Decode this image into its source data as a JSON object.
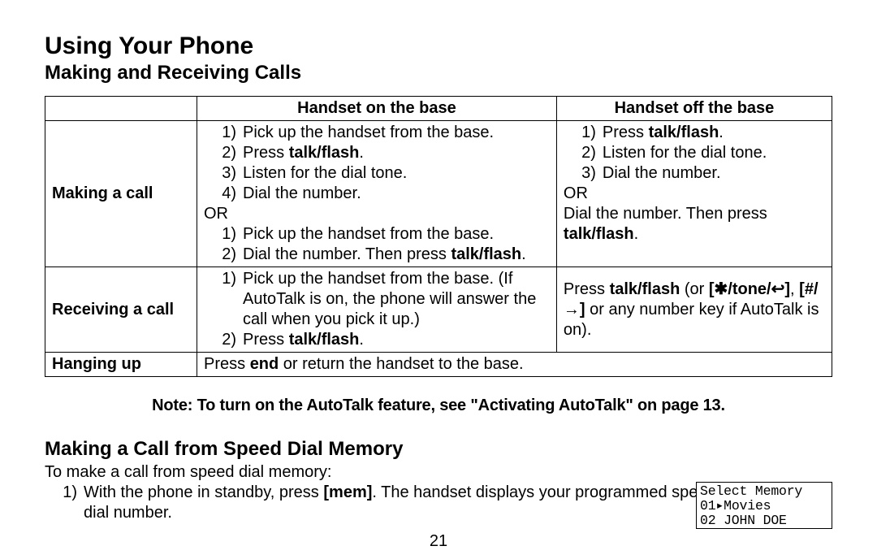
{
  "title": "Using Your Phone",
  "subtitle": "Making and Receiving Calls",
  "table": {
    "head_on": "Handset on the base",
    "head_off": "Handset off the base",
    "row1": {
      "label": "Making a call",
      "on": {
        "a1": "Pick up the handset from the base.",
        "a2_pre": "Press ",
        "a2_b": "talk/flash",
        "a2_post": ".",
        "a3": "Listen for the dial tone.",
        "a4": "Dial the number.",
        "or": "OR",
        "b1": "Pick up the handset from the base.",
        "b2_pre": "Dial the number. Then press ",
        "b2_b": "talk/flash",
        "b2_post": "."
      },
      "off": {
        "a1_pre": "Press ",
        "a1_b": "talk/flash",
        "a1_post": ".",
        "a2": "Listen for the dial tone.",
        "a3": "Dial the number.",
        "or": "OR",
        "b_pre": "Dial the number. Then press ",
        "b_b": "talk/flash",
        "b_post": "."
      }
    },
    "row2": {
      "label": "Receiving a call",
      "on": {
        "s1": "Pick up the handset from the base. (If AutoTalk is on, the phone will answer the call when you pick it up.)",
        "s2_pre": "Press ",
        "s2_b": "talk/flash",
        "s2_post": "."
      },
      "off_pre": "Press ",
      "off_b1": "talk/flash",
      "off_mid1": " (or ",
      "off_b2": "[✱/tone/↩]",
      "off_mid2": ", ",
      "off_b3": "[#/→]",
      "off_post": " or any number key if AutoTalk is on)."
    },
    "row3": {
      "label": "Hanging up",
      "text_pre": "Press ",
      "text_b": "end",
      "text_post": " or return the handset to the base."
    }
  },
  "note": "Note: To turn on the AutoTalk feature, see \"Activating AutoTalk\" on page 13.",
  "section2": {
    "title": "Making a Call from Speed Dial Memory",
    "intro": "To make a call from speed dial memory:",
    "step1_pre": "With the phone in standby, press ",
    "step1_b": "mem",
    "step1_post": ". The handset displays your programmed speed dial number."
  },
  "lcd": {
    "l1": "Select Memory",
    "l2": "01▸Movies",
    "l3": "02 JOHN DOE"
  },
  "pagenum": "21"
}
